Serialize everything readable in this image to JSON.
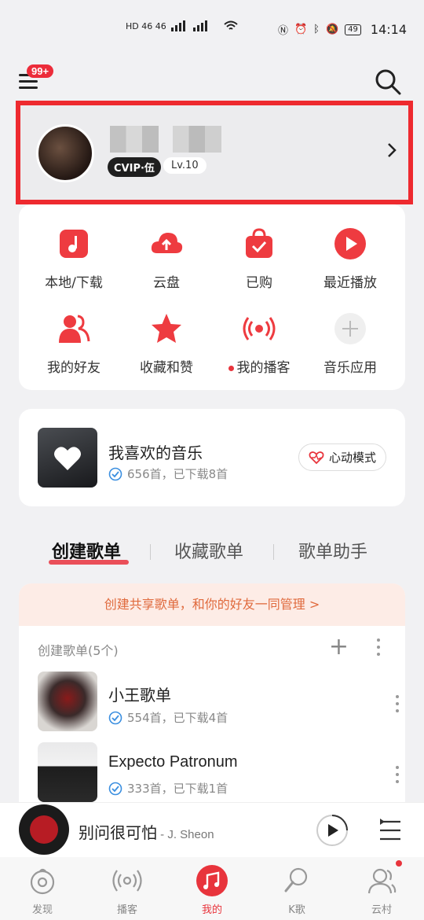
{
  "status_bar": {
    "left": "HD 46 46",
    "time": "14:14",
    "battery": "49"
  },
  "header": {
    "notification_badge": "99+"
  },
  "profile": {
    "vip_badge": "CVIP·伍",
    "level": "Lv.10"
  },
  "quick_actions": [
    {
      "label": "本地/下载"
    },
    {
      "label": "云盘"
    },
    {
      "label": "已购"
    },
    {
      "label": "最近播放"
    },
    {
      "label": "我的好友"
    },
    {
      "label": "收藏和赞"
    },
    {
      "label": "我的播客"
    },
    {
      "label": "音乐应用"
    }
  ],
  "liked": {
    "title": "我喜欢的音乐",
    "subtitle": "656首，已下载8首",
    "mode_button": "心动模式"
  },
  "tabs": [
    {
      "label": "创建歌单"
    },
    {
      "label": "收藏歌单"
    },
    {
      "label": "歌单助手"
    }
  ],
  "playlists": {
    "share_banner": "创建共享歌单，和你的好友一同管理 >",
    "header": "创建歌单(5个)",
    "items": [
      {
        "title": "小王歌单",
        "subtitle": "554首，已下载4首"
      },
      {
        "title": "Expecto Patronum",
        "subtitle": "333首，已下载1首"
      }
    ]
  },
  "player": {
    "song": "别问很可怕",
    "artist": " - J. Sheon"
  },
  "nav": [
    {
      "label": "发现"
    },
    {
      "label": "播客"
    },
    {
      "label": "我的"
    },
    {
      "label": "K歌"
    },
    {
      "label": "云村"
    }
  ],
  "colors": {
    "accent": "#e8343c",
    "highlight_box": "#ee2a2f"
  }
}
